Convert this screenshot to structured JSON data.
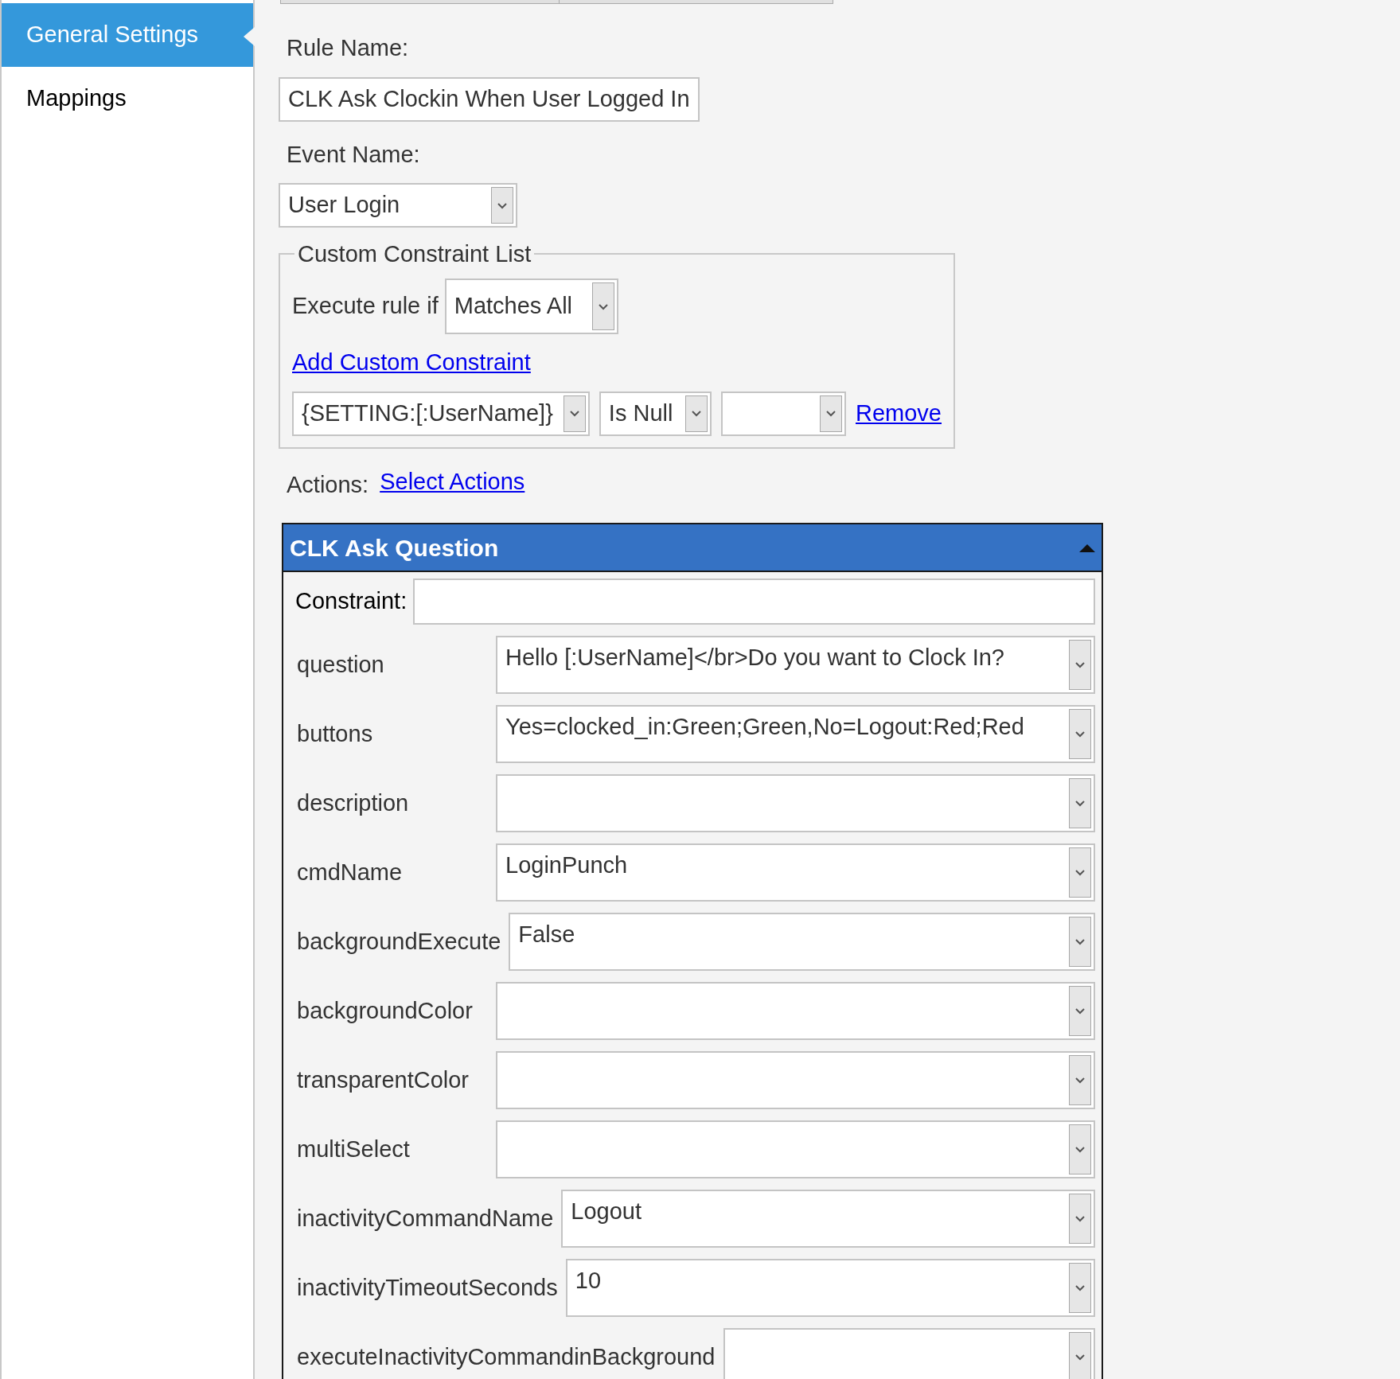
{
  "sidebar": {
    "items": [
      {
        "label": "General Settings",
        "selected": true
      },
      {
        "label": "Mappings",
        "selected": false
      }
    ]
  },
  "rule_name": {
    "label": "Rule Name:",
    "value": "CLK Ask Clockin When User Logged In"
  },
  "event_name": {
    "label": "Event Name:",
    "value": "User Login"
  },
  "custom_constraint_list": {
    "title": "Custom Constraint List",
    "execute_label": "Execute rule if",
    "execute_value": "Matches All",
    "add_link": "Add Custom Constraint",
    "constraints": [
      {
        "field": "{SETTING:[:UserName]}",
        "operator": "Is Null",
        "remove_link": "Remove"
      }
    ]
  },
  "actions": {
    "label": "Actions:",
    "select_link": "Select Actions"
  },
  "action_panel": {
    "title": "CLK Ask Question",
    "expanded": true,
    "constraint_label": "Constraint:",
    "fields": [
      {
        "label": "question",
        "value": "Hello [:UserName]</br>Do you want to Clock In?"
      },
      {
        "label": "buttons",
        "value": "Yes=clocked_in:Green;Green,No=Logout:Red;Red"
      },
      {
        "label": "description"
      },
      {
        "label": "cmdName",
        "value": "LoginPunch"
      },
      {
        "label": "backgroundExecute",
        "value": "False"
      },
      {
        "label": "backgroundColor"
      },
      {
        "label": "transparentColor"
      },
      {
        "label": "multiSelect"
      },
      {
        "label": "inactivityCommandName",
        "value": "Logout"
      },
      {
        "label": "inactivityTimeoutSeconds",
        "value": "10"
      },
      {
        "label": "executeInactivityCommandinBackground"
      }
    ]
  }
}
